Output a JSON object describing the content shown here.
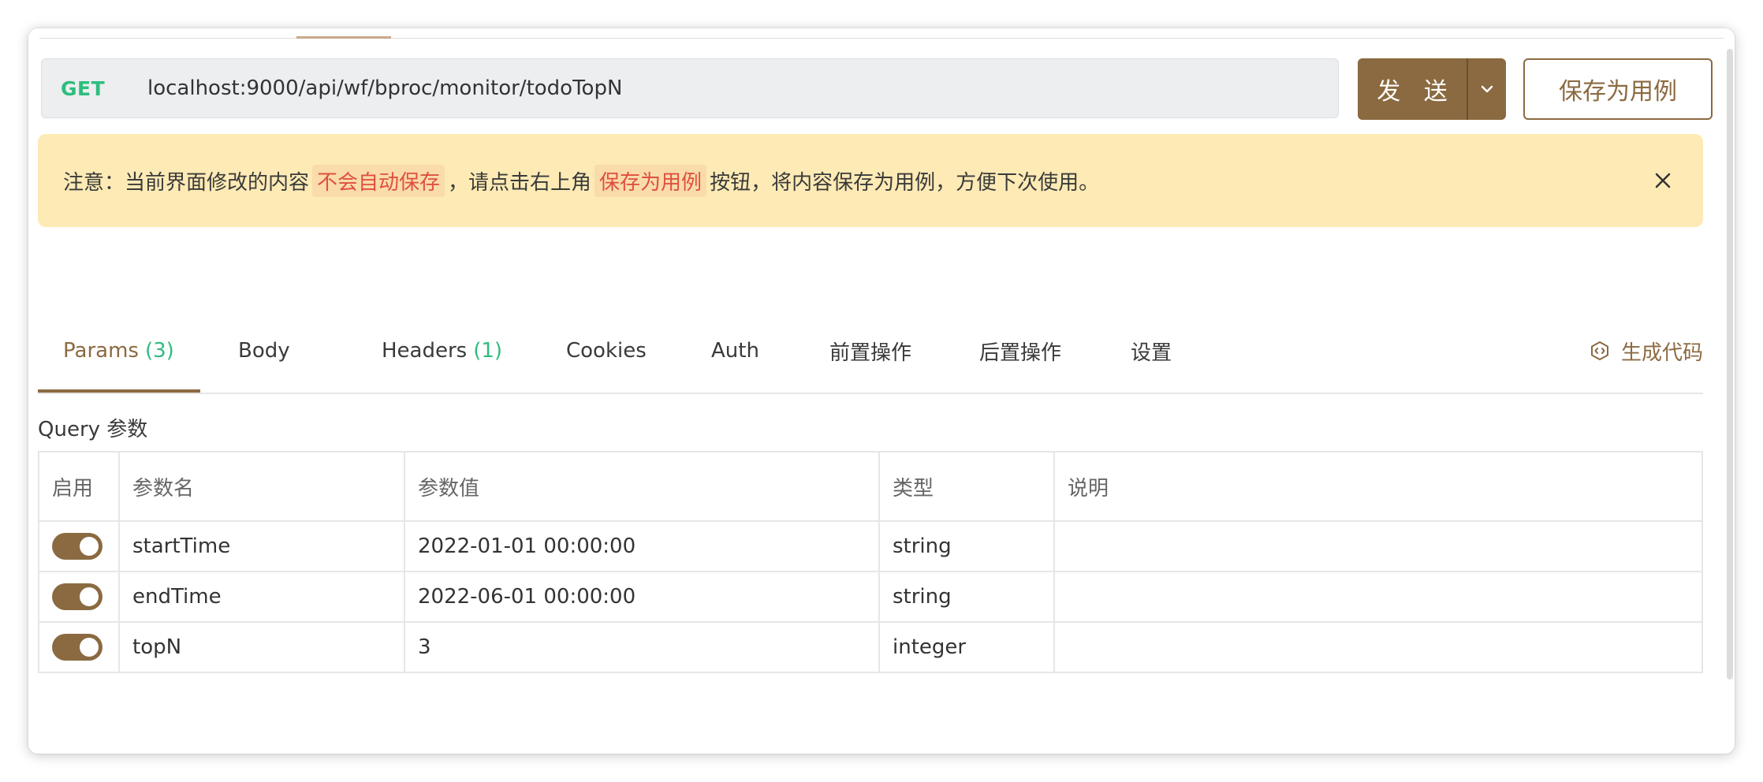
{
  "request": {
    "method": "GET",
    "url": "localhost:9000/api/wf/bproc/monitor/todoTopN",
    "send_label": "发 送",
    "save_case_label": "保存为用例"
  },
  "notice": {
    "prefix": "注意：当前界面修改的内容",
    "tag1": "不会自动保存",
    "middle": "，请点击右上角",
    "tag2": "保存为用例",
    "suffix": "按钮，将内容保存为用例，方便下次使用。"
  },
  "tabs": [
    {
      "label": "Params",
      "count": "(3)"
    },
    {
      "label": "Body",
      "count": ""
    },
    {
      "label": "Headers",
      "count": "(1)"
    },
    {
      "label": "Cookies",
      "count": ""
    },
    {
      "label": "Auth",
      "count": ""
    },
    {
      "label": "前置操作",
      "count": ""
    },
    {
      "label": "后置操作",
      "count": ""
    },
    {
      "label": "设置",
      "count": ""
    }
  ],
  "generate_code_label": "生成代码",
  "query": {
    "title": "Query 参数",
    "headers": [
      "启用",
      "参数名",
      "参数值",
      "类型",
      "说明"
    ],
    "rows": [
      {
        "enabled": true,
        "name": "startTime",
        "value": "2022-01-01 00:00:00",
        "type": "string",
        "desc": ""
      },
      {
        "enabled": true,
        "name": "endTime",
        "value": "2022-06-01 00:00:00",
        "type": "string",
        "desc": ""
      },
      {
        "enabled": true,
        "name": "topN",
        "value": "3",
        "type": "integer",
        "desc": ""
      }
    ]
  },
  "colors": {
    "accent": "#8b6a41",
    "method_get": "#2ebd7e",
    "notice_bg": "#fdeab5",
    "notice_tag_text": "#e0503f"
  }
}
